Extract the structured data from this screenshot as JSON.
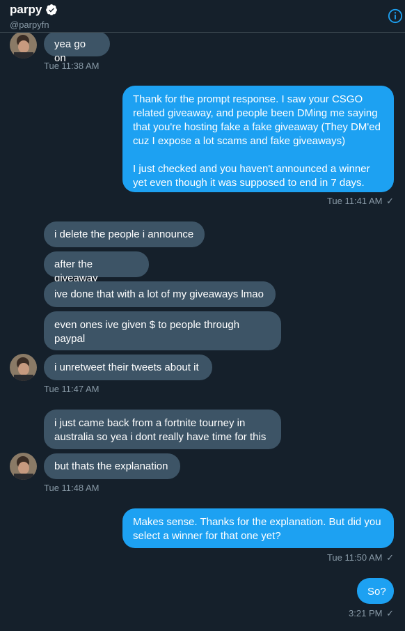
{
  "header": {
    "name": "parpy",
    "handle": "@parpyfn"
  },
  "colors": {
    "background": "#15202b",
    "incoming_bubble": "#3d5466",
    "outgoing_bubble": "#1da1f2",
    "muted_text": "#8899a6"
  },
  "icons": {
    "verified": "verified-badge-icon",
    "info": "info-icon",
    "check": "checkmark-icon"
  },
  "messages": [
    {
      "dir": "in",
      "text": "yea go on"
    },
    {
      "dir": "in_ts",
      "text": "Tue 11:38 AM"
    },
    {
      "dir": "out",
      "text": "Thank for the prompt response. I saw your CSGO related giveaway, and people been DMing me saying that you're hosting fake a fake giveaway (They DM'ed cuz I expose a lot scams and fake giveaways)\n\nI just checked and you haven't announced a winner yet even though it was supposed to end in 7 days."
    },
    {
      "dir": "out_ts",
      "text": "Tue 11:41 AM"
    },
    {
      "dir": "in",
      "text": "i delete the people i announce"
    },
    {
      "dir": "in",
      "text": "after the giveaway"
    },
    {
      "dir": "in",
      "text": "ive done that with a lot of my giveaways lmao"
    },
    {
      "dir": "in",
      "text": "even ones ive given $ to people through paypal"
    },
    {
      "dir": "in",
      "text": "i unretweet their tweets about it"
    },
    {
      "dir": "in_ts",
      "text": "Tue 11:47 AM"
    },
    {
      "dir": "in",
      "text": "i just came back from a fortnite tourney in australia so yea i dont really have time for this"
    },
    {
      "dir": "in",
      "text": "but thats the explanation"
    },
    {
      "dir": "in_ts",
      "text": "Tue 11:48 AM"
    },
    {
      "dir": "out",
      "text": "Makes sense. Thanks for the explanation. But did you select a winner for that one yet?"
    },
    {
      "dir": "out_ts",
      "text": "Tue 11:50 AM"
    },
    {
      "dir": "out",
      "text": "So?"
    },
    {
      "dir": "out_ts",
      "text": "3:21 PM"
    }
  ]
}
